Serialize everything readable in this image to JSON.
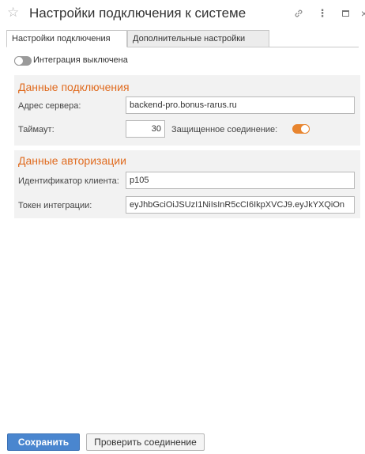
{
  "window": {
    "title": "Настройки подключения к системе",
    "star_icon": "☆",
    "dots_icon": "⋮",
    "close_icon": "×"
  },
  "tabs": [
    {
      "label": "Настройки подключения",
      "active": true
    },
    {
      "label": "Дополнительные настройки",
      "active": false
    }
  ],
  "integration": {
    "label": "Интеграция выключена",
    "enabled": false
  },
  "connection": {
    "title": "Данные подключения",
    "server_label": "Адрес сервера:",
    "server_value": "backend-pro.bonus-rarus.ru",
    "timeout_label": "Таймаут:",
    "timeout_value": "30",
    "secure_label": "Защищенное соединение:",
    "secure_enabled": true
  },
  "auth": {
    "title": "Данные авторизации",
    "client_id_label": "Идентификатор клиента:",
    "client_id_value": "p105",
    "token_label": "Токен интеграции:",
    "token_value": "eyJhbGciOiJSUzI1NiIsInR5cCI6IkpXVCJ9.eyJkYXQiOn"
  },
  "buttons": {
    "save": "Сохранить",
    "check": "Проверить соединение"
  },
  "colors": {
    "accent": "#e06b1f",
    "toggle_on": "#e8852f",
    "primary_button": "#4a86cf"
  }
}
